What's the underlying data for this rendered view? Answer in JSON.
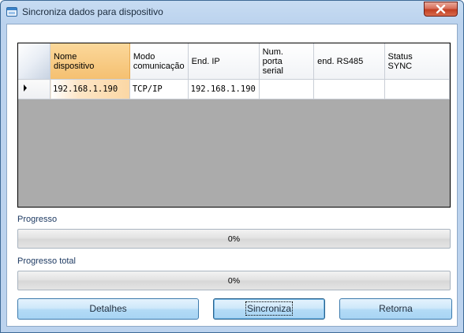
{
  "window": {
    "title": "Sincroniza dados para dispositivo"
  },
  "grid": {
    "columns": [
      {
        "label": "Nome\ndispositivo"
      },
      {
        "label": "Modo\ncomunicação"
      },
      {
        "label": "End. IP"
      },
      {
        "label": "Num.\nporta\nserial"
      },
      {
        "label": "end. RS485"
      },
      {
        "label": "Status\nSYNC"
      }
    ],
    "rows": [
      {
        "cells": [
          "192.168.1.190",
          "TCP/IP",
          "192.168.1.190",
          "",
          "",
          ""
        ]
      }
    ]
  },
  "progress": {
    "label": "Progresso",
    "value": 0,
    "text": "0%"
  },
  "progress_total": {
    "label": "Progresso total",
    "value": 0,
    "text": "0%"
  },
  "buttons": {
    "details": "Detalhes",
    "sync": "Sincroniza",
    "back": "Retorna"
  },
  "colors": {
    "title_bar": "#bcd3ee",
    "selected_header": "#f5c071",
    "button": "#b3dbf6",
    "grid_background": "#ababab"
  }
}
